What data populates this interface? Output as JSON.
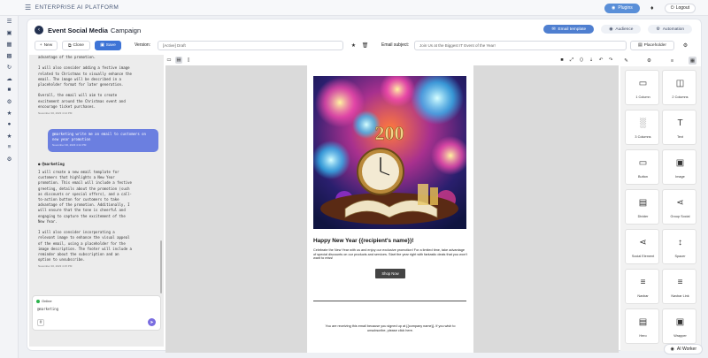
{
  "app": {
    "brand": "ENTERPRISE AI PLATFORM",
    "plugins_label": "Plugins",
    "logout_label": "Logout"
  },
  "rail_icons": [
    "home-icon",
    "layers-icon",
    "dashboard-icon",
    "grid-icon",
    "layout-icon",
    "calendar-icon",
    "refresh-icon",
    "cloud-icon",
    "gift-icon",
    "settings-sliders-icon",
    "star-icon",
    "badge-icon",
    "star-icon",
    "bookmark-icon",
    "list-icon",
    "gear-icon"
  ],
  "header": {
    "title": "Event Social Media",
    "title_suffix": "Campaign",
    "tabs": [
      {
        "label": "Email template",
        "active": true
      },
      {
        "label": "Audience",
        "active": false
      },
      {
        "label": "Automation",
        "active": false
      }
    ]
  },
  "toolbar": {
    "new_label": "New",
    "clone_label": "Clone",
    "save_label": "Save",
    "version_label": "Version:",
    "version_value": "[Active] Draft",
    "email_subject_label": "Email subject:",
    "email_subject_value": "Join Us at the Biggest IT Event of the Year!",
    "placeholder_label": "Placeholder"
  },
  "chat": {
    "messages": [
      {
        "role": "agent",
        "text": "advantage of the promotion.\n\nI will also consider adding a festive image\nrelated to Christmas to visually enhance the\nemail. The image will be described in a\nplaceholder format for later generation.\n\nOverall, the email will aim to create\nexcitement around the Christmas event and\nencourage ticket purchases.",
        "time": "November 30, 2023 4:14 PM"
      },
      {
        "role": "user",
        "text": "@marketing write me an email to customers on\nnew year promotion",
        "time": "November 30, 2023 4:14 PM"
      },
      {
        "role": "agent",
        "name": "@marketing",
        "text": "I will create a new email template for\ncustomers that highlights a New Year\npromotion. This email will include a festive\ngreeting, details about the promotion (such\nas discounts or special offers), and a call-\nto-action button for customers to take\nadvantage of the promotion. Additionally, I\nwill ensure that the tone is cheerful and\nengaging to capture the excitement of the\nNew Year.\n\nI will also consider incorporating a\nrelevant image to enhance the visual appeal\nof the email, using a placeholder for the\nimage description. The footer will include a\nreminder about the subscription and an\noption to unsubscribe.",
        "time": "November 30, 2023 4:15 PM"
      }
    ],
    "status": "Online",
    "input_value": "@marketing"
  },
  "email": {
    "hero_text": "200",
    "headline": "Happy New Year {{recipient's name}}!",
    "body": "Celebrate the New Year with us and enjoy our exclusive promotion! For a limited time, take advantage of special discounts on our products and services. Start the year right with fantastic deals that you won't want to miss!",
    "button_label": "Shop Now",
    "footer": "You are receiving this email because you signed up at {{company name}}. If you wish to unsubscribe, please click here."
  },
  "blocks": [
    {
      "label": "1 Column",
      "icon": "one-column-icon"
    },
    {
      "label": "2 Columns",
      "icon": "two-columns-icon"
    },
    {
      "label": "3 Columns",
      "icon": "three-columns-icon"
    },
    {
      "label": "Text",
      "icon": "text-icon"
    },
    {
      "label": "Button",
      "icon": "button-icon"
    },
    {
      "label": "Image",
      "icon": "image-icon"
    },
    {
      "label": "Divider",
      "icon": "divider-icon"
    },
    {
      "label": "Group Social",
      "icon": "share-icon"
    },
    {
      "label": "Social Element",
      "icon": "share-icon"
    },
    {
      "label": "Spacer",
      "icon": "spacer-icon"
    },
    {
      "label": "Navbar",
      "icon": "navbar-icon"
    },
    {
      "label": "Navbar Link",
      "icon": "navbar-link-icon"
    },
    {
      "label": "Hero",
      "icon": "hero-icon"
    },
    {
      "label": "Wrapper",
      "icon": "wrapper-icon"
    }
  ],
  "ai_worker_label": "AI Worker",
  "colors": {
    "primary": "#3e74d6",
    "tab_active": "#4f7fd0",
    "user_bubble": "#6b7fe0",
    "online": "#2bb24c",
    "plugins": "#5a8fd8"
  }
}
